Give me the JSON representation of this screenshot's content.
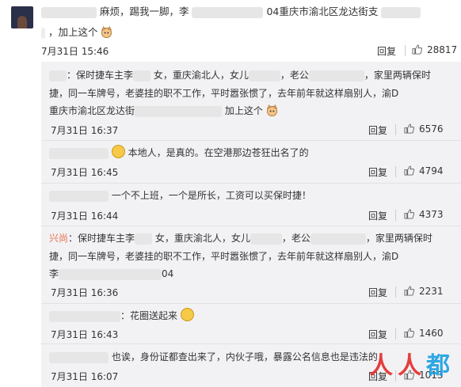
{
  "main_comment": {
    "line1": "麻烦，踢我一脚，李",
    "line1_tail": "04重庆市渝北区龙达街支",
    "line2": "，加上这个",
    "time": "7月31日 15:46",
    "reply_label": "回复",
    "likes": "28817"
  },
  "replies": [
    {
      "prefix": "：保时捷车主李",
      "seg1": "女，重庆渝北人，女儿",
      "seg2": "，老公",
      "seg3": "，家里两辆保时",
      "line2": "捷，同一车牌号，老婆挂的职不工作，平时嚣张惯了，去年前年就这样扇别人，渝D",
      "line3a": "重庆市渝北区龙达街",
      "line3b": "加上这个",
      "time": "7月31日 16:37",
      "reply_label": "回复",
      "likes": "6576"
    },
    {
      "text": "本地人，是真的。在空港那边苍狂出名了的",
      "time": "7月31日 16:45",
      "reply_label": "回复",
      "likes": "4794"
    },
    {
      "text": "一个不上班，一个是所长，工资可以买保时捷！",
      "time": "7月31日 16:44",
      "reply_label": "回复",
      "likes": "4373"
    },
    {
      "name": "兴尚",
      "prefix": "：保时捷车主李",
      "seg1": "女，重庆渝北人，女儿",
      "seg2": "，老公",
      "seg3": "，家里两辆保时",
      "line2": "捷，同一车牌号，老婆挂的职不工作，平时嚣张惯了，去年前年就这样扇别人，渝D",
      "line3a": "李",
      "line3b": "04",
      "time": "7月31日 16:36",
      "reply_label": "回复",
      "likes": "2231"
    },
    {
      "text": "：花圈送起来",
      "time": "7月31日 16:43",
      "reply_label": "回复",
      "likes": "1460"
    },
    {
      "text": "也诶，身份证都查出来了，内伙子哦，暴露公名信息也是违法的",
      "time": "7月31日 16:07",
      "reply_label": "回复",
      "likes": "1013"
    }
  ],
  "watermark": "人人都是产品经理",
  "colors": {
    "accent": "#eb7350",
    "reply_bg": "#f2f2f5"
  }
}
